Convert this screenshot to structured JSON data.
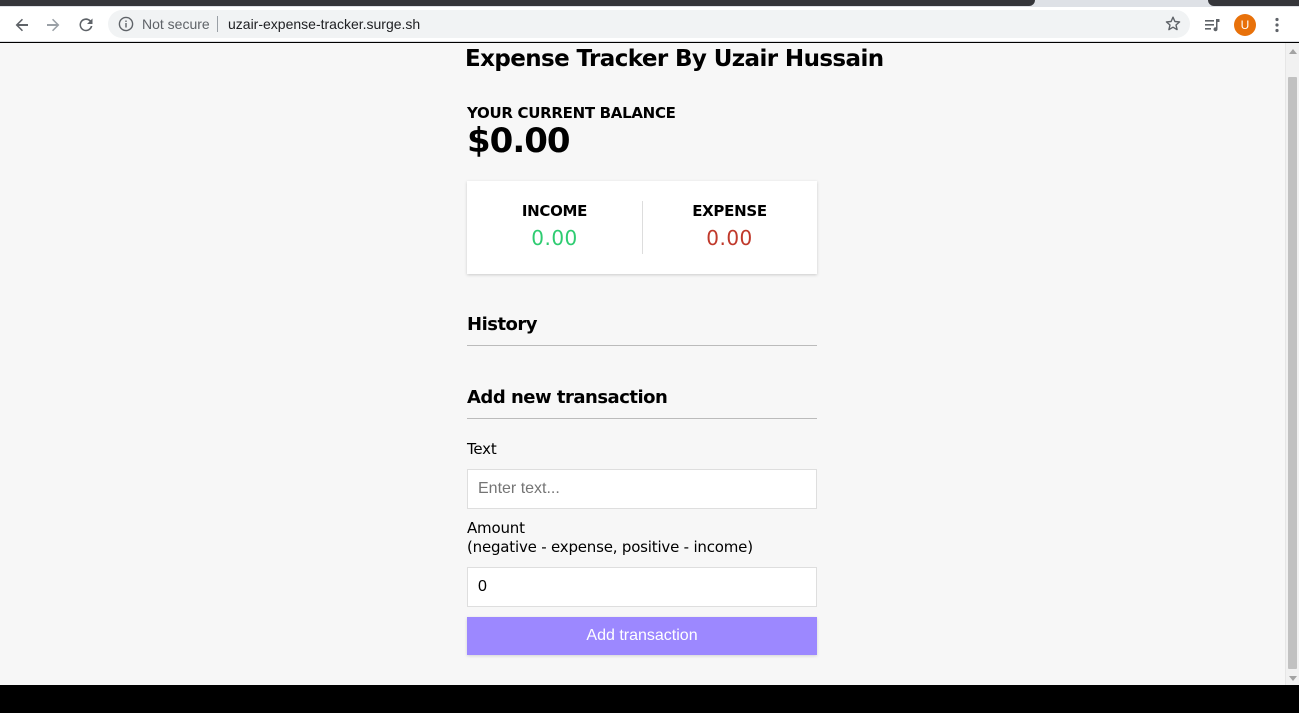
{
  "browser": {
    "security_text": "Not secure",
    "url": "uzair-expense-tracker.surge.sh",
    "profile_initial": "U",
    "icons": {
      "back": "back-arrow-icon",
      "forward": "forward-arrow-icon",
      "reload": "reload-icon",
      "info": "info-icon",
      "bookmark": "star-icon",
      "media": "media-queue-icon",
      "menu": "kebab-menu-icon"
    },
    "colors": {
      "avatar": "#e8710a"
    }
  },
  "app": {
    "title": "Expense Tracker By Uzair Hussain",
    "balance_label": "YOUR CURRENT BALANCE",
    "balance_value": "$0.00",
    "income_label": "INCOME",
    "income_value": "0.00",
    "expense_label": "EXPENSE",
    "expense_value": "0.00",
    "history_heading": "History",
    "add_heading": "Add new transaction",
    "text_label": "Text",
    "text_placeholder": "Enter text...",
    "amount_label_line1": "Amount",
    "amount_label_line2": "(negative - expense, positive - income)",
    "amount_value": "0",
    "submit_label": "Add transaction",
    "colors": {
      "income": "#2ecc71",
      "expense": "#c0392b",
      "button": "#9c88ff"
    }
  }
}
